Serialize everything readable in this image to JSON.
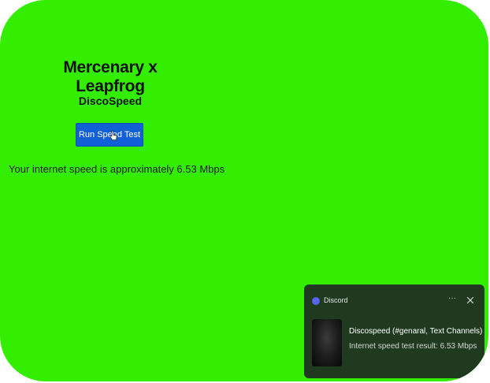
{
  "page": {
    "title": "Mercenary x Leapfrog",
    "subtitle": "DiscoSpeed",
    "run_button_label": "Run Speed Test",
    "result_text": "Your internet speed is approximately 6.53 Mbps"
  },
  "colors": {
    "background": "#33ee00",
    "button": "#1160d6",
    "toast_background": "#1f3a1e",
    "discord_brand": "#5865f2"
  },
  "notification": {
    "app_name": "Discord",
    "app_icon": "discord-icon",
    "more_glyph": "···",
    "heading": "Discospeed (#genaral, Text Channels)",
    "body": "Internet speed test result: 6.53 Mbps"
  }
}
